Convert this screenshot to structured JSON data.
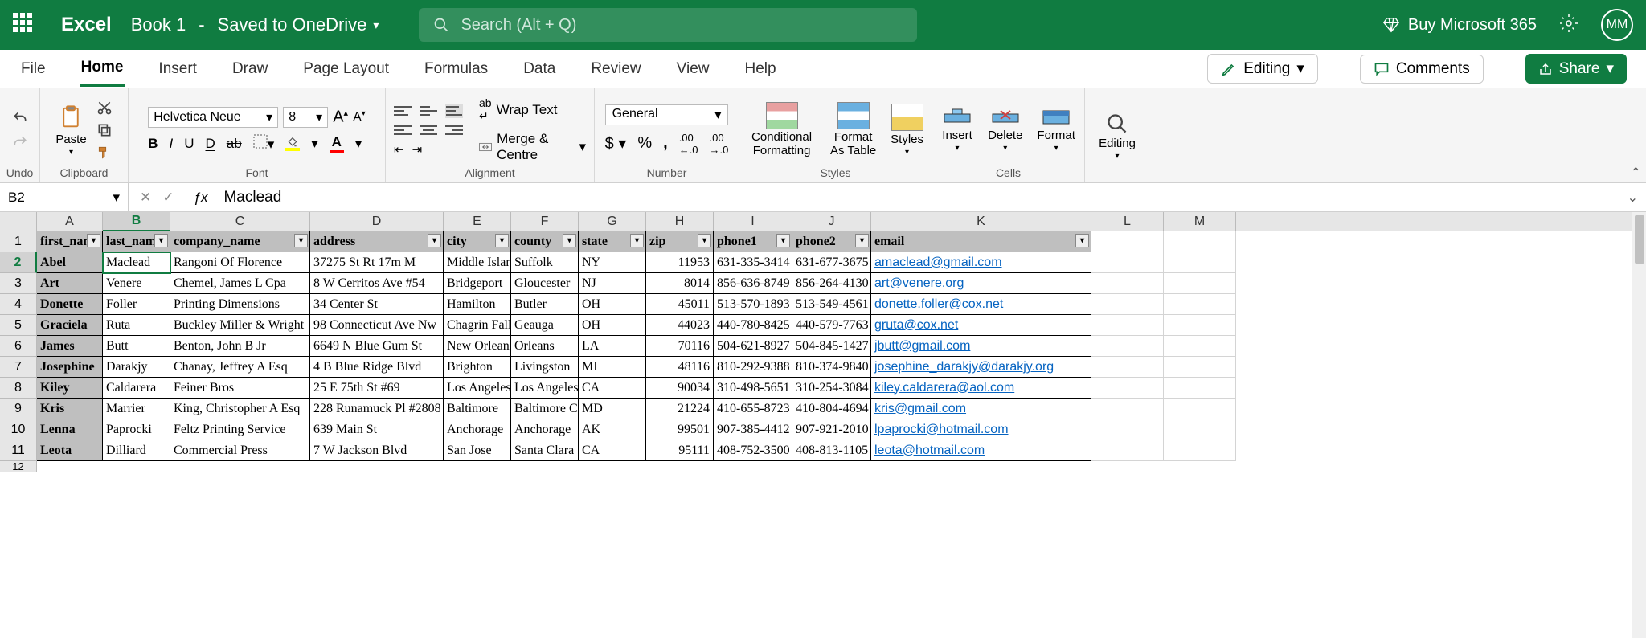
{
  "header": {
    "app_name": "Excel",
    "doc_name": "Book 1",
    "saved_status": "Saved to OneDrive",
    "search_placeholder": "Search (Alt + Q)",
    "buy_label": "Buy Microsoft 365",
    "avatar_initials": "MM"
  },
  "tabs": {
    "file": "File",
    "home": "Home",
    "insert": "Insert",
    "draw": "Draw",
    "page_layout": "Page Layout",
    "formulas": "Formulas",
    "data": "Data",
    "review": "Review",
    "view": "View",
    "help": "Help",
    "editing_mode": "Editing",
    "comments": "Comments",
    "share": "Share"
  },
  "ribbon": {
    "undo_label": "Undo",
    "clipboard_label": "Clipboard",
    "paste": "Paste",
    "font_label": "Font",
    "font_name": "Helvetica Neue",
    "font_size": "8",
    "alignment_label": "Alignment",
    "wrap_text": "Wrap Text",
    "merge_centre": "Merge & Centre",
    "number_label": "Number",
    "number_format": "General",
    "styles_label": "Styles",
    "conditional_formatting": "Conditional Formatting",
    "format_as_table": "Format As Table",
    "styles": "Styles",
    "cells_label": "Cells",
    "insert": "Insert",
    "delete": "Delete",
    "format": "Format",
    "editing_label": "Editing",
    "editing": "Editing"
  },
  "formula_bar": {
    "cell_ref": "B2",
    "value": "Maclead"
  },
  "columns": [
    "A",
    "B",
    "C",
    "D",
    "E",
    "F",
    "G",
    "H",
    "I",
    "J",
    "K",
    "L",
    "M"
  ],
  "headers": {
    "first_name": "first_name",
    "last_name": "last_name",
    "company_name": "company_name",
    "address": "address",
    "city": "city",
    "county": "county",
    "state": "state",
    "zip": "zip",
    "phone1": "phone1",
    "phone2": "phone2",
    "email": "email"
  },
  "rows": [
    {
      "n": "2",
      "first_name": "Abel",
      "last_name": "Maclead",
      "company_name": "Rangoni Of Florence",
      "address": "37275 St  Rt 17m M",
      "city": "Middle Island",
      "county": "Suffolk",
      "state": "NY",
      "zip": "11953",
      "phone1": "631-335-3414",
      "phone2": "631-677-3675",
      "email": "amaclead@gmail.com"
    },
    {
      "n": "3",
      "first_name": "Art",
      "last_name": "Venere",
      "company_name": "Chemel, James L Cpa",
      "address": "8 W Cerritos Ave #54",
      "city": "Bridgeport",
      "county": "Gloucester",
      "state": "NJ",
      "zip": "8014",
      "phone1": "856-636-8749",
      "phone2": "856-264-4130",
      "email": "art@venere.org"
    },
    {
      "n": "4",
      "first_name": "Donette",
      "last_name": "Foller",
      "company_name": "Printing Dimensions",
      "address": "34 Center St",
      "city": "Hamilton",
      "county": "Butler",
      "state": "OH",
      "zip": "45011",
      "phone1": "513-570-1893",
      "phone2": "513-549-4561",
      "email": "donette.foller@cox.net"
    },
    {
      "n": "5",
      "first_name": "Graciela",
      "last_name": "Ruta",
      "company_name": "Buckley Miller & Wright",
      "address": "98 Connecticut Ave Nw",
      "city": "Chagrin Falls",
      "county": "Geauga",
      "state": "OH",
      "zip": "44023",
      "phone1": "440-780-8425",
      "phone2": "440-579-7763",
      "email": "gruta@cox.net"
    },
    {
      "n": "6",
      "first_name": "James",
      "last_name": "Butt",
      "company_name": "Benton, John B Jr",
      "address": "6649 N Blue Gum St",
      "city": "New Orleans",
      "county": "Orleans",
      "state": "LA",
      "zip": "70116",
      "phone1": "504-621-8927",
      "phone2": "504-845-1427",
      "email": "jbutt@gmail.com"
    },
    {
      "n": "7",
      "first_name": "Josephine",
      "last_name": "Darakjy",
      "company_name": "Chanay, Jeffrey A Esq",
      "address": "4 B Blue Ridge Blvd",
      "city": "Brighton",
      "county": "Livingston",
      "state": "MI",
      "zip": "48116",
      "phone1": "810-292-9388",
      "phone2": "810-374-9840",
      "email": "josephine_darakjy@darakjy.org"
    },
    {
      "n": "8",
      "first_name": "Kiley",
      "last_name": "Caldarera",
      "company_name": "Feiner Bros",
      "address": "25 E 75th St #69",
      "city": "Los Angeles",
      "county": "Los Angeles",
      "state": "CA",
      "zip": "90034",
      "phone1": "310-498-5651",
      "phone2": "310-254-3084",
      "email": "kiley.caldarera@aol.com"
    },
    {
      "n": "9",
      "first_name": "Kris",
      "last_name": "Marrier",
      "company_name": "King, Christopher A Esq",
      "address": "228 Runamuck Pl #2808",
      "city": "Baltimore",
      "county": "Baltimore City",
      "state": "MD",
      "zip": "21224",
      "phone1": "410-655-8723",
      "phone2": "410-804-4694",
      "email": "kris@gmail.com"
    },
    {
      "n": "10",
      "first_name": "Lenna",
      "last_name": "Paprocki",
      "company_name": "Feltz Printing Service",
      "address": "639 Main St",
      "city": "Anchorage",
      "county": "Anchorage",
      "state": "AK",
      "zip": "99501",
      "phone1": "907-385-4412",
      "phone2": "907-921-2010",
      "email": "lpaprocki@hotmail.com"
    },
    {
      "n": "11",
      "first_name": "Leota",
      "last_name": "Dilliard",
      "company_name": "Commercial Press",
      "address": "7 W Jackson Blvd",
      "city": "San Jose",
      "county": "Santa Clara",
      "state": "CA",
      "zip": "95111",
      "phone1": "408-752-3500",
      "phone2": "408-813-1105",
      "email": "leota@hotmail.com"
    }
  ]
}
